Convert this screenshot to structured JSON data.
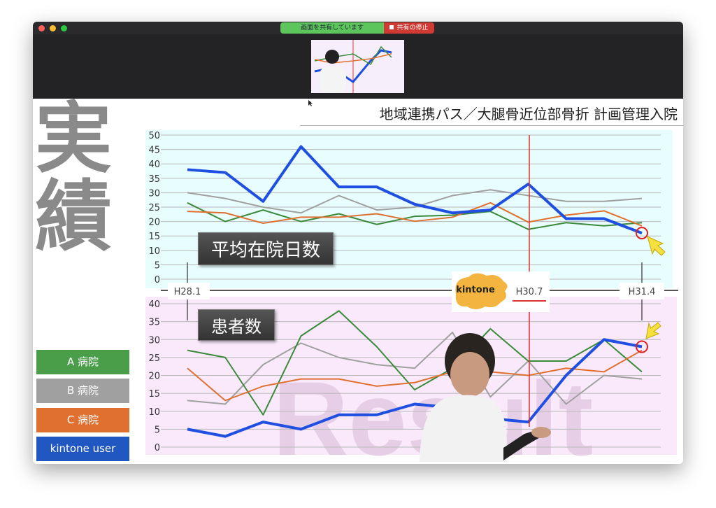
{
  "window": {
    "share_status": "画面を共有しています",
    "stop_share": "共有の停止",
    "traffic_colors": [
      "#fe5f57",
      "#febc2e",
      "#28c840"
    ]
  },
  "slide": {
    "side_title": [
      "実",
      "績"
    ],
    "title": "地域連携パス／大腿骨近位部骨折 計画管理入院",
    "watermark": "Result",
    "kintone_logo": "kintone",
    "legend": [
      {
        "label": "A 病院",
        "color": "#4a9e4a"
      },
      {
        "label": "B 病院",
        "color": "#a0a0a0"
      },
      {
        "label": "C 病院",
        "color": "#e07030"
      },
      {
        "label": "kintone user",
        "color": "#2157c0"
      }
    ],
    "time_axis": {
      "start": "H28.1",
      "mid": "H30.7",
      "end": "H31.4"
    }
  },
  "chart_data": [
    {
      "type": "line",
      "title": "平均在院日数",
      "ylim": [
        0,
        50
      ],
      "yticks": [
        0,
        5,
        10,
        15,
        20,
        25,
        30,
        35,
        40,
        45,
        50
      ],
      "x": [
        1,
        2,
        3,
        4,
        5,
        6,
        7,
        8,
        9,
        10,
        11,
        12,
        13
      ],
      "grid": true,
      "series": [
        {
          "name": "B 病院",
          "color": "#a0a0a0",
          "values": [
            30,
            28,
            25,
            23,
            29,
            24,
            25,
            29,
            31,
            29,
            27,
            27,
            28
          ]
        },
        {
          "name": "A 病院",
          "color": "#3a8a3a",
          "values": [
            26.5,
            20,
            24,
            20,
            22.7,
            19,
            21.8,
            22.2,
            23.5,
            17.3,
            19.6,
            18.5,
            19.6
          ]
        },
        {
          "name": "C 病院",
          "color": "#e07030",
          "values": [
            23.5,
            23,
            19.4,
            21.5,
            21.5,
            22.7,
            20.1,
            21.5,
            26.5,
            19.8,
            22.2,
            23.7,
            18.5
          ]
        },
        {
          "name": "kintone user",
          "color": "#1f4fe0",
          "values": [
            38,
            37,
            27,
            46,
            32,
            32,
            26,
            23,
            24,
            33,
            21,
            21,
            16
          ]
        }
      ]
    },
    {
      "type": "line",
      "title": "患者数",
      "ylim": [
        0,
        40
      ],
      "yticks": [
        0,
        5,
        10,
        15,
        20,
        25,
        30,
        35,
        40
      ],
      "x": [
        1,
        2,
        3,
        4,
        5,
        6,
        7,
        8,
        9,
        10,
        11,
        12,
        13
      ],
      "grid": true,
      "series": [
        {
          "name": "B 病院",
          "color": "#a0a0a0",
          "values": [
            13,
            12,
            23,
            29,
            25,
            23,
            22,
            32,
            14,
            24,
            12,
            20,
            19
          ]
        },
        {
          "name": "A 病院",
          "color": "#3a8a3a",
          "values": [
            27,
            25,
            9,
            31,
            38,
            28,
            16,
            22,
            33,
            24,
            24,
            30,
            21
          ]
        },
        {
          "name": "C 病院",
          "color": "#e07030",
          "values": [
            22,
            13,
            17,
            19,
            19,
            17,
            18,
            21,
            21,
            20,
            22,
            21,
            27
          ]
        },
        {
          "name": "kintone user",
          "color": "#1f4fe0",
          "values": [
            5,
            3,
            7,
            5,
            9,
            9,
            12,
            11,
            8,
            7,
            20,
            30,
            28
          ]
        }
      ]
    }
  ]
}
